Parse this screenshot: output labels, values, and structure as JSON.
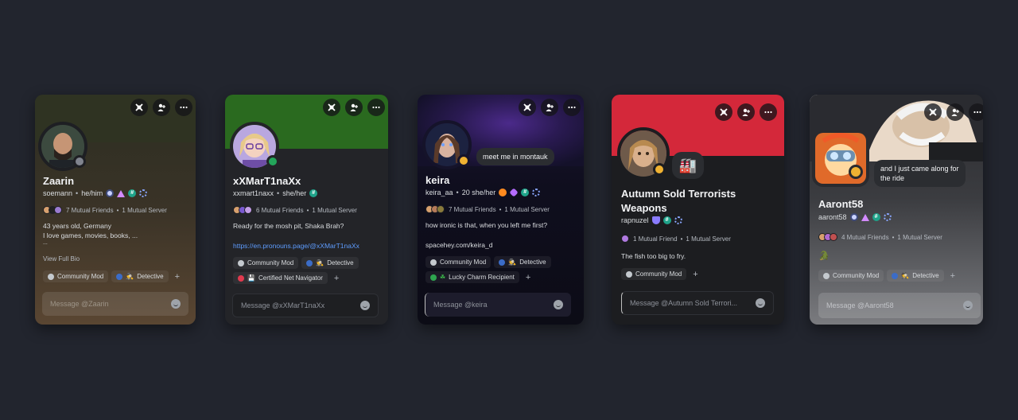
{
  "cards": {
    "zaarin": {
      "display_name": "Zaarin",
      "username": "soemann",
      "pronouns": "he/him",
      "mutual_friends": "7 Mutual Friends",
      "mutual_servers": "1 Mutual Server",
      "bio_line1": "43 years old, Germany",
      "bio_line2": "I love games, movies, books, ...",
      "bio_line3": "...",
      "view_full_bio": "View Full Bio",
      "roles": [
        "Community Mod",
        "Detective"
      ],
      "message_placeholder": "Message @Zaarin"
    },
    "xxmartina": {
      "display_name": "xXMarT1naXx",
      "username": "xxmart1naxx",
      "pronouns": "she/her",
      "mutual_friends": "6 Mutual Friends",
      "mutual_servers": "1 Mutual Server",
      "bio_line1": "Ready for the mosh pit, Shaka Brah?",
      "bio_link": "https://en.pronouns.page/@xXMarT1naXx",
      "roles": [
        "Community Mod",
        "Detective",
        "Certified Net Navigator"
      ],
      "message_placeholder": "Message @xXMarT1naXx"
    },
    "keira": {
      "display_name": "keira",
      "username": "keira_aa",
      "pronouns": "20 she/her",
      "status_bubble": "meet me in montauk",
      "mutual_friends": "7 Mutual Friends",
      "mutual_servers": "1 Mutual Server",
      "bio_line1": "how ironic is that, when you left me first?",
      "bio_line2": "spacehey.com/keira_d",
      "roles": [
        "Community Mod",
        "Detective",
        "Lucky Charm Recipient"
      ],
      "message_placeholder": "Message @keira"
    },
    "autumn": {
      "display_name_line1": "Autumn Sold Terrorists",
      "display_name_line2": "Weapons",
      "username": "rapnuzel",
      "mutual_friends": "1 Mutual Friend",
      "mutual_servers": "1 Mutual Server",
      "bio_line1": "The fish too big to fry.",
      "roles": [
        "Community Mod"
      ],
      "message_placeholder": "Message @Autumn Sold Terrori..."
    },
    "aaront": {
      "display_name": "Aaront58",
      "username": "aaront58",
      "status_bubble_line1": "and I just came along for",
      "status_bubble_line2": "the ride",
      "mutual_friends": "4 Mutual Friends",
      "mutual_servers": "1 Mutual Server",
      "bio_emoji": "🐊",
      "roles": [
        "Community Mod",
        "Detective"
      ],
      "message_placeholder": "Message @Aaront58"
    }
  },
  "separator": "•",
  "add_role": "+",
  "colors": {
    "background": "#22252e",
    "community_mod_dot": "#c4c9ce",
    "detective_dot": "#3b6cc7",
    "certified_dot": "#e03a4e",
    "lucky_dot": "#2ea44f",
    "autumn_banner": "#d4283a",
    "martina_banner": "#2a6a1f"
  },
  "icons": [
    "no-tools-icon",
    "person-add-icon",
    "more-icon",
    "emoji-icon",
    "status-dot-icon"
  ]
}
